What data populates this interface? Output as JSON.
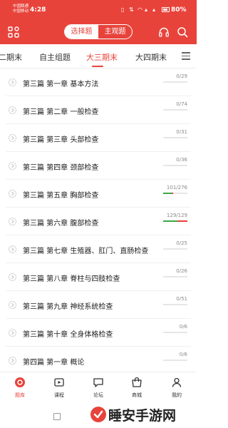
{
  "status_bar": {
    "carrier_line1": "中国联通",
    "carrier_line2": "中国移动",
    "time": "4:28",
    "battery": "80%"
  },
  "header": {
    "segments": [
      "选择题",
      "主观题"
    ],
    "selected_segment": "选择题"
  },
  "tabs": {
    "items": [
      "二期末",
      "自主组题",
      "大三期末",
      "大四期末"
    ],
    "active": "大三期末"
  },
  "chapters": [
    {
      "title": "第三篇 第一章 基本方法",
      "count": "0/29",
      "done": 0,
      "wrong": 0
    },
    {
      "title": "第三篇 第二章 一般检查",
      "count": "0/74",
      "done": 0,
      "wrong": 0
    },
    {
      "title": "第三篇 第三章 头部检查",
      "count": "0/31",
      "done": 0,
      "wrong": 0
    },
    {
      "title": "第三篇 第四章 颈部检查",
      "count": "0/36",
      "done": 0,
      "wrong": 0
    },
    {
      "title": "第三篇 第五章 胸部检查",
      "count": "101/276",
      "done": 0.366,
      "wrong": 0.06
    },
    {
      "title": "第三篇 第六章 腹部检查",
      "count": "129/129",
      "done": 0.6,
      "wrong": 0.4
    },
    {
      "title": "第三篇 第七章 生殖器、肛门、直肠检查",
      "count": "0/25",
      "done": 0,
      "wrong": 0
    },
    {
      "title": "第三篇 第八章 脊柱与四肢检查",
      "count": "0/26",
      "done": 0,
      "wrong": 0
    },
    {
      "title": "第三篇 第九章 神经系统检查",
      "count": "0/51",
      "done": 0,
      "wrong": 0
    },
    {
      "title": "第三篇 第十章 全身体格检查",
      "count": "0/6",
      "done": 0,
      "wrong": 0
    },
    {
      "title": "第四篇 第一章 概论",
      "count": "0/6",
      "done": 0,
      "wrong": 0
    }
  ],
  "bottom_nav": [
    {
      "label": "题库",
      "icon": "question-bank-icon",
      "active": true
    },
    {
      "label": "课程",
      "icon": "course-icon",
      "active": false
    },
    {
      "label": "论坛",
      "icon": "forum-icon",
      "active": false
    },
    {
      "label": "商城",
      "icon": "shop-icon",
      "active": false
    },
    {
      "label": "我的",
      "icon": "profile-icon",
      "active": false
    }
  ],
  "watermark": "睡安手游网",
  "colors": {
    "accent": "#e8433b",
    "progress_green": "#3aa845"
  }
}
